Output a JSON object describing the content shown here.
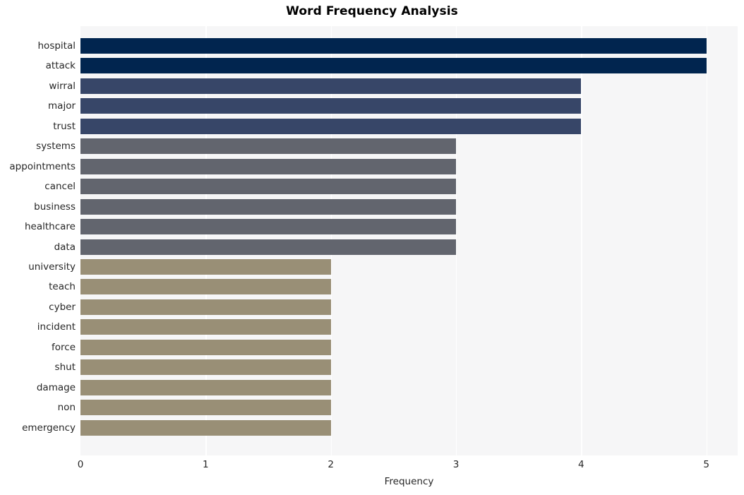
{
  "chart_data": {
    "type": "bar",
    "orientation": "horizontal",
    "title": "Word Frequency Analysis",
    "xlabel": "Frequency",
    "ylabel": "",
    "xlim": [
      0,
      5.25
    ],
    "xticks": [
      0,
      1,
      2,
      3,
      4,
      5
    ],
    "xtick_labels": [
      "0",
      "1",
      "2",
      "3",
      "4",
      "5"
    ],
    "grid": true,
    "grid_axis": "x",
    "legend": "none",
    "plot_background": "#f6f6f7",
    "gridline_color": "#ffffff",
    "categories": [
      "hospital",
      "attack",
      "wirral",
      "major",
      "trust",
      "systems",
      "appointments",
      "cancel",
      "business",
      "healthcare",
      "data",
      "university",
      "teach",
      "cyber",
      "incident",
      "force",
      "shut",
      "damage",
      "non",
      "emergency"
    ],
    "values": [
      5,
      5,
      4,
      4,
      4,
      3,
      3,
      3,
      3,
      3,
      3,
      2,
      2,
      2,
      2,
      2,
      2,
      2,
      2,
      2
    ],
    "bar_colors": [
      "#01254f",
      "#01254f",
      "#374668",
      "#374668",
      "#374668",
      "#62656e",
      "#62656e",
      "#62656e",
      "#62656e",
      "#62656e",
      "#62656e",
      "#998f76",
      "#998f76",
      "#998f76",
      "#998f76",
      "#998f76",
      "#998f76",
      "#998f76",
      "#998f76",
      "#998f76"
    ],
    "palette": {
      "value_5": "#01254f",
      "value_4": "#374668",
      "value_3": "#62656e",
      "value_2": "#998f76"
    }
  }
}
